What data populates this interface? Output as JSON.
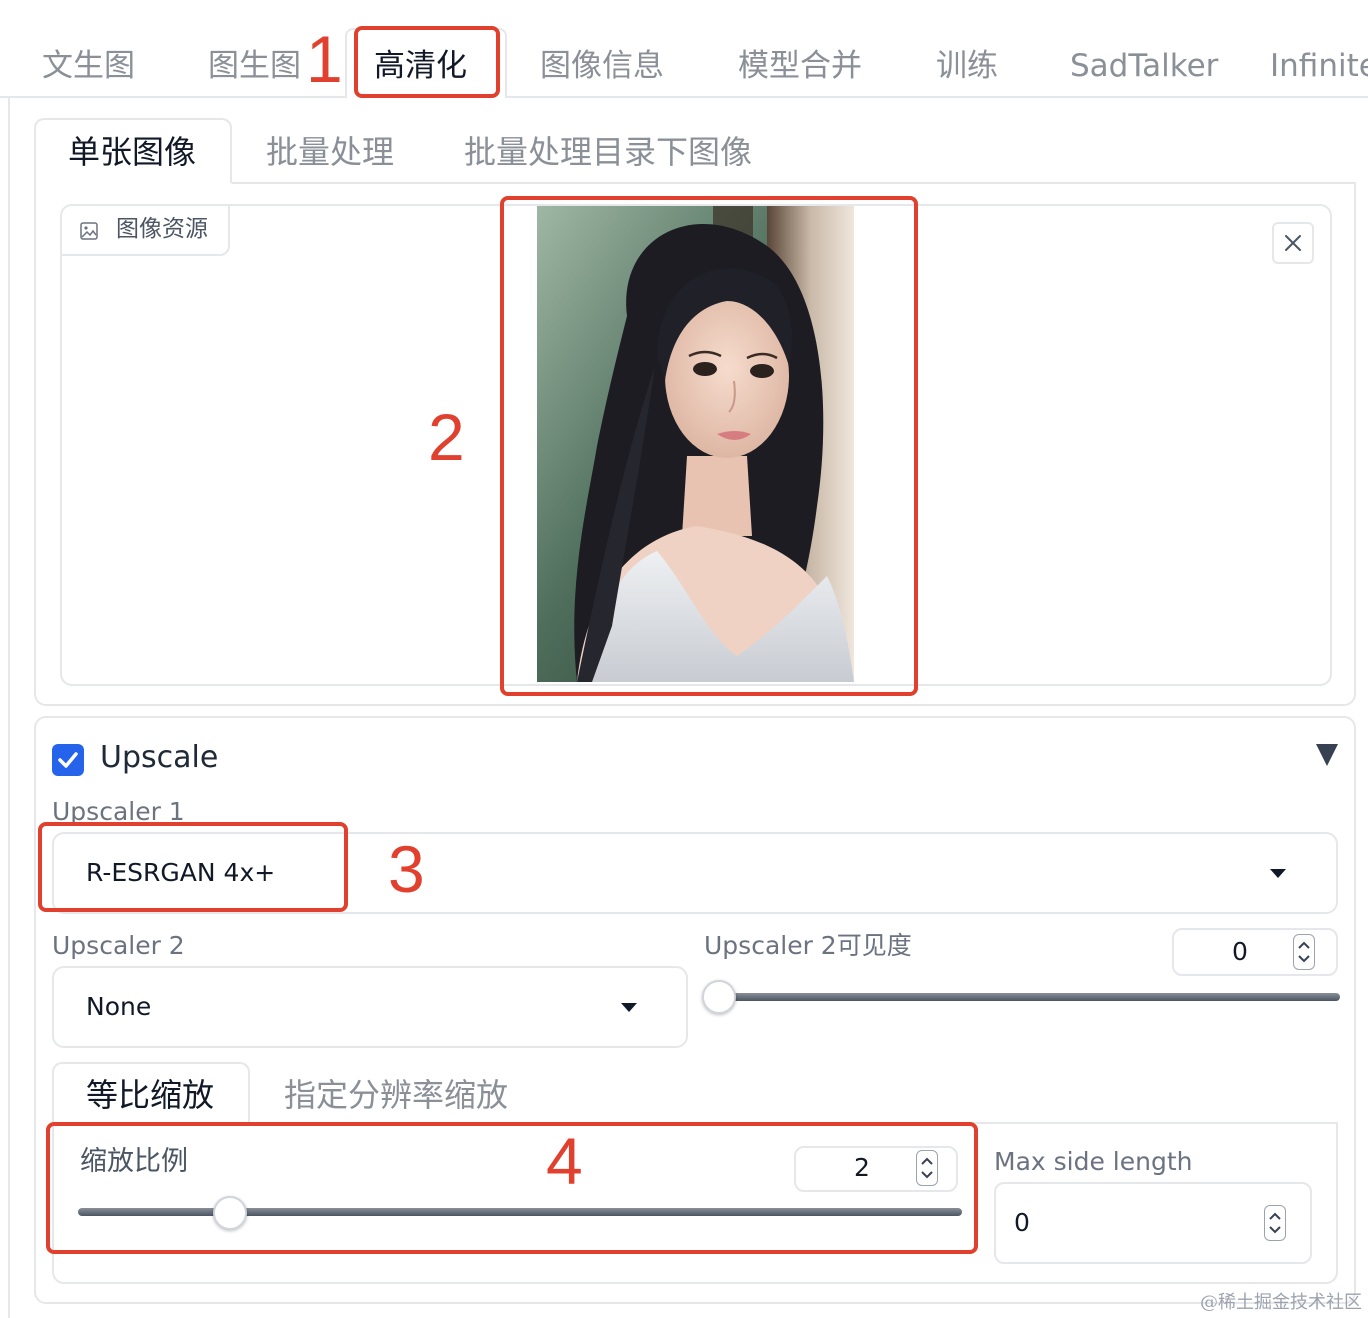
{
  "top_tabs": [
    "文生图",
    "图生图",
    "高清化",
    "图像信息",
    "模型合并",
    "训练",
    "SadTalker",
    "Infinite"
  ],
  "active_top_tab": "高清化",
  "sub_tabs": [
    "单张图像",
    "批量处理",
    "批量处理目录下图像"
  ],
  "image_source": {
    "label": "图像资源",
    "close_icon": "×"
  },
  "upscale": {
    "title": "Upscale",
    "checked": true,
    "upscaler1": {
      "label": "Upscaler 1",
      "value": "R-ESRGAN 4x+"
    },
    "upscaler2": {
      "label": "Upscaler 2",
      "value": "None"
    },
    "upscaler2_visibility": {
      "label": "Upscaler 2可见度",
      "value": "0",
      "fraction": 0
    },
    "scale_tabs": [
      "等比缩放",
      "指定分辨率缩放"
    ],
    "scale_by": {
      "label": "缩放比例",
      "value": "2",
      "fraction": 0.155
    },
    "max_side_length": {
      "label": "Max side length",
      "value": "0"
    }
  },
  "annotations": [
    "1",
    "2",
    "3",
    "4"
  ],
  "watermark": "@稀土掘金技术社区",
  "colors": {
    "accent": "#2563eb",
    "annotation": "#e0402d"
  }
}
